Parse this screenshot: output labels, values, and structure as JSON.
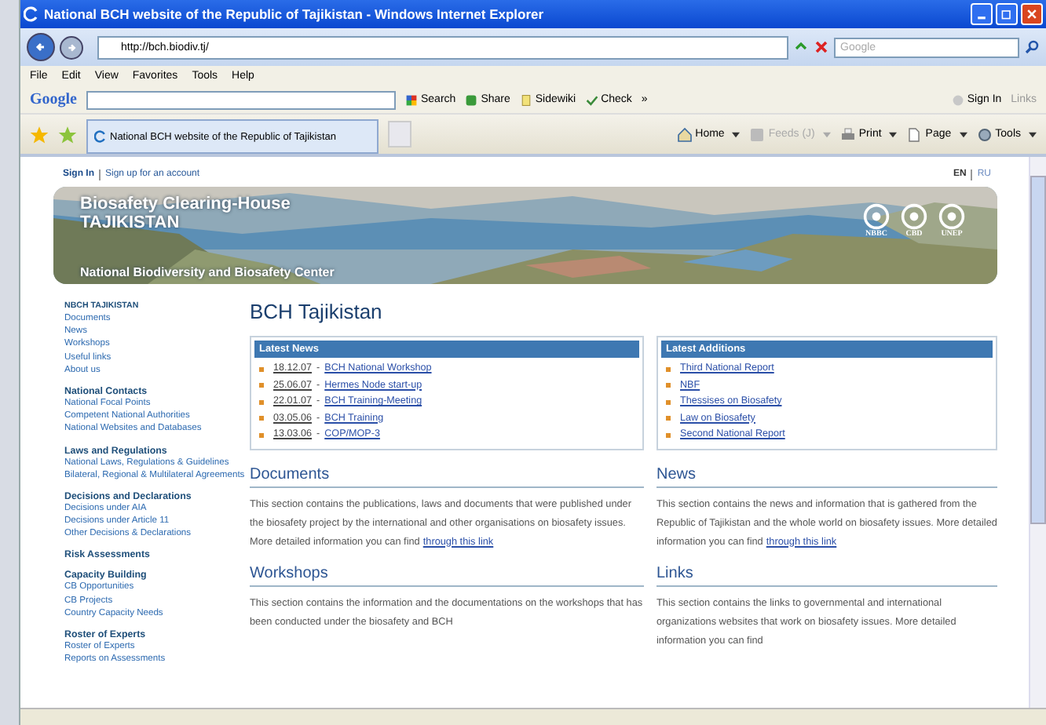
{
  "window": {
    "title": "National BCH website of the Republic of Tajikistan - Windows Internet Explorer"
  },
  "address_bar": {
    "url": "http://bch.biodiv.tj/",
    "search_placeholder": "Google"
  },
  "menu": [
    "File",
    "Edit",
    "View",
    "Favorites",
    "Tools",
    "Help"
  ],
  "google_toolbar": {
    "logo": "Google",
    "items": [
      {
        "label": "Search",
        "kind": "search"
      },
      {
        "label": "Share",
        "kind": "share"
      },
      {
        "label": "Sidewiki",
        "kind": "sidewiki"
      },
      {
        "label": "Check",
        "kind": "check"
      }
    ],
    "more": "»",
    "sign_in": "Sign In",
    "links": "Links"
  },
  "tab": {
    "label": "National BCH website of the Republic of Tajikistan",
    "selected": true
  },
  "command_bar": [
    {
      "label": "Home",
      "kind": "home",
      "disabled": false
    },
    {
      "label": "Feeds (J)",
      "kind": "feeds",
      "disabled": true
    },
    {
      "label": "Print",
      "kind": "print",
      "disabled": false
    },
    {
      "label": "Page",
      "kind": "page",
      "disabled": false
    },
    {
      "label": "Tools",
      "kind": "tools",
      "disabled": false
    }
  ],
  "page": {
    "account_links": [
      "Sign In",
      "Sign up for an account"
    ],
    "languages": [
      {
        "label": "EN",
        "selected": true
      },
      {
        "label": "RU",
        "selected": false
      }
    ],
    "banner": {
      "title_lines": [
        "Biosafety Clearing-House",
        "TAJIKISTAN"
      ],
      "subtitle": "National Biodiversity and Biosafety Center",
      "logos": [
        "NBBC",
        "CBD",
        "UNEP"
      ]
    },
    "sidebar": [
      {
        "heading": "NBCH TAJIKISTAN",
        "items": [
          "Documents",
          "News",
          "Workshops",
          "Useful links",
          "About us"
        ]
      },
      {
        "heading": "National Contacts",
        "items": [
          "National Focal Points",
          "Competent National Authorities",
          "National Websites and Databases"
        ]
      },
      {
        "heading": "Laws and Regulations",
        "items": [
          "National Laws, Regulations & Guidelines",
          "Bilateral, Regional & Multilateral Agreements"
        ]
      },
      {
        "heading": "Decisions and Declarations",
        "items": [
          "Decisions under AIA",
          "Decisions under Article 11",
          "Other Decisions & Declarations"
        ]
      },
      {
        "heading": "Risk Assessments"
      },
      {
        "heading": "Capacity Building",
        "items": [
          "CB Opportunities",
          "CB Projects",
          "Country Capacity Needs"
        ]
      },
      {
        "heading": "Roster of Experts",
        "items": [
          "Roster of Experts",
          "Reports on Assessments"
        ]
      }
    ],
    "heading": "BCH Tajikistan",
    "latest_news": {
      "title": "Latest News",
      "separator": "-",
      "items": [
        {
          "date": "18.12.07",
          "title": "BCH National Workshop"
        },
        {
          "date": "25.06.07",
          "title": "Hermes Node start-up"
        },
        {
          "date": "22.01.07",
          "title": "BCH Training-Meeting"
        },
        {
          "date": "03.05.06",
          "title": "BCH Training"
        },
        {
          "date": "13.03.06",
          "title": "COP/MOP-3"
        }
      ]
    },
    "latest_additions": {
      "title": "Latest Additions",
      "items": [
        "Third National Report",
        "NBF",
        "Thessises on Biosafety",
        "Law on Biosafety",
        "Second National Report"
      ]
    },
    "left_sections": [
      {
        "title": "Documents",
        "text": "This section contains the publications, laws and documents that were published under the biosafety project by the international and other organisations on biosafety issues. More detailed information you can find",
        "link": "through this link"
      },
      {
        "title": "Workshops",
        "text": "This section contains the information and the documentations on the workshops that has been conducted under the biosafety and BCH"
      }
    ],
    "right_sections": [
      {
        "title": "News",
        "text": "This section contains the news and information that is gathered from the Republic of Tajikistan and the whole world on biosafety issues. More detailed information you can find",
        "link": "through this link"
      },
      {
        "title": "Links",
        "text": "This section contains the links to governmental and international organizations websites that work on biosafety issues. More detailed information you can find"
      }
    ]
  }
}
